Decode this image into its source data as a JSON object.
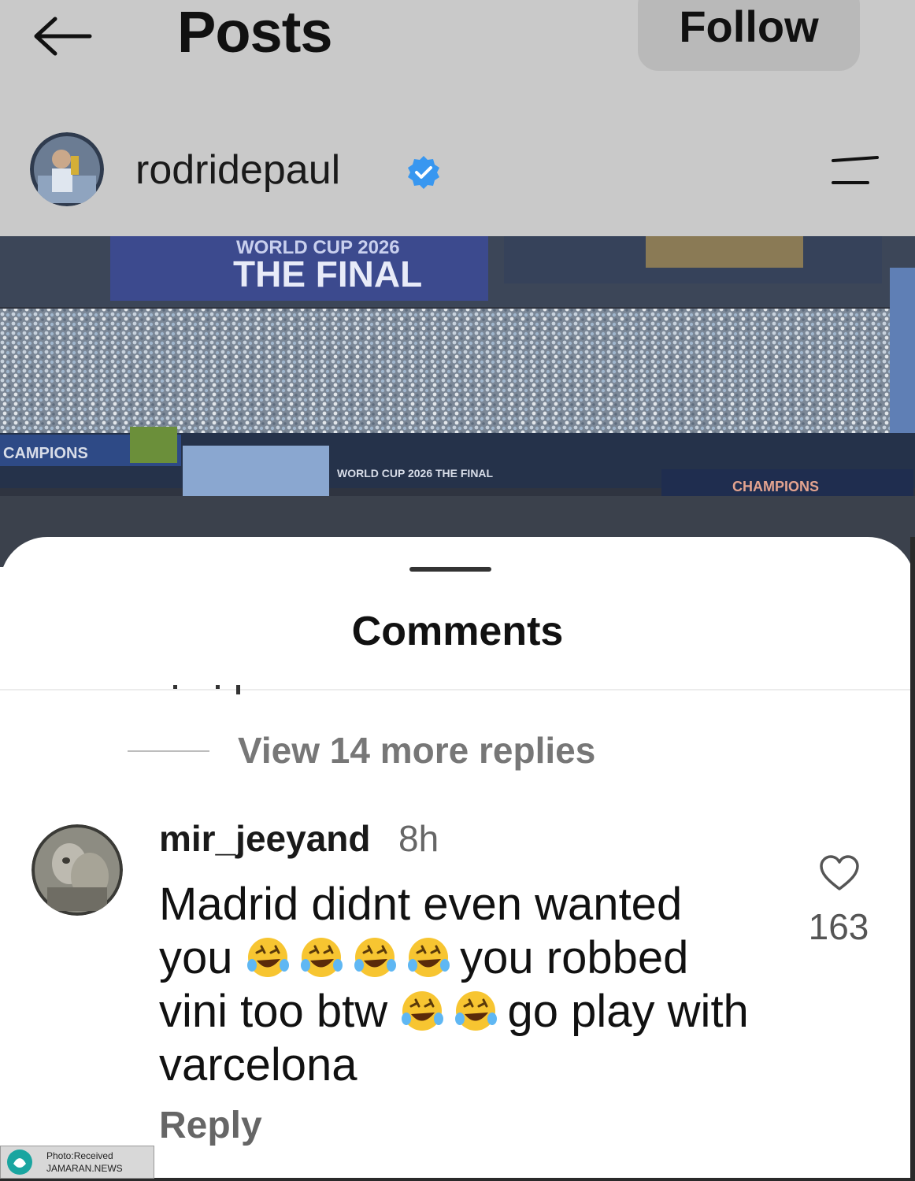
{
  "header": {
    "title": "Posts",
    "follow_label": "Follow"
  },
  "post": {
    "username": "rodridepaul",
    "verified": true,
    "photo_banner_line1": "WORLD CUP 2026",
    "photo_banner_line2": "THE FINAL",
    "photo_ribbon_left": "CAMPIONS",
    "photo_ribbon_center": "WORLD CUP 2026  THE FINAL",
    "photo_ribbon_right": "CHAMPIONS"
  },
  "comments_sheet": {
    "title": "Comments",
    "view_replies": "View 14 more replies",
    "comment": {
      "username": "mir_jeeyand",
      "time": "8h",
      "text_part1": "Madrid didnt even wanted you",
      "text_part2": "you robbed vini too btw",
      "text_part3": "go play with varcelona",
      "emoji_name": "rolling-on-the-floor-laughing",
      "reply_label": "Reply",
      "like_count": "163"
    }
  },
  "watermark": {
    "line1": "Photo:Received",
    "line2": "JAMARAN.NEWS"
  },
  "colors": {
    "header_bg": "#c9c9c9",
    "verified_blue": "#3897f0",
    "muted_text": "#777777"
  }
}
